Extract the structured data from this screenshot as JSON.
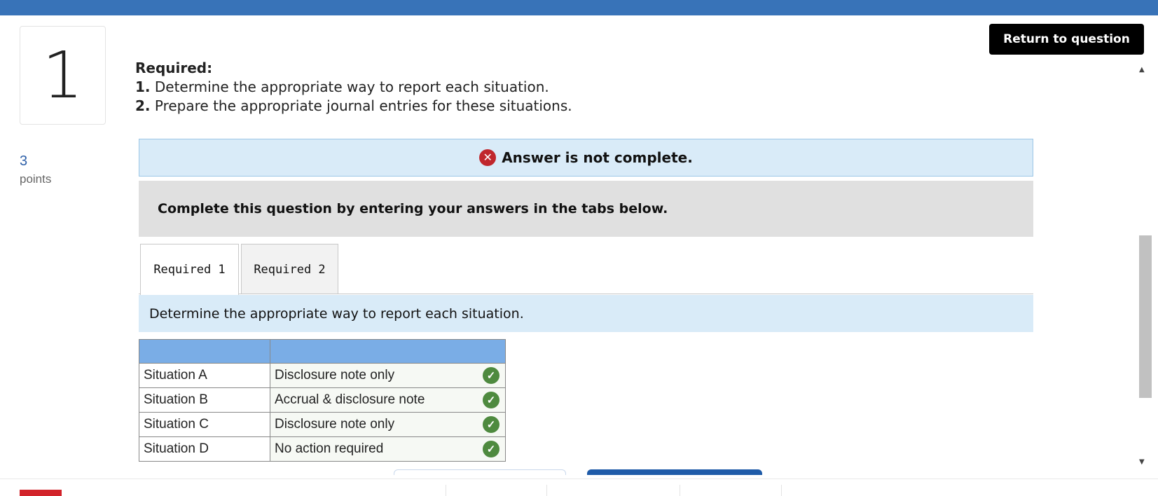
{
  "question": {
    "number": "1",
    "points_value": "3",
    "points_label": "points"
  },
  "header": {
    "return_label": "Return to question"
  },
  "required": {
    "title": "Required:",
    "items": [
      {
        "num": "1.",
        "text": "Determine the appropriate way to report each situation."
      },
      {
        "num": "2.",
        "text": "Prepare the appropriate journal entries for these situations."
      }
    ]
  },
  "alert": {
    "text": "Answer is not complete."
  },
  "instructions": {
    "text": "Complete this question by entering your answers in the tabs below."
  },
  "tabs": [
    {
      "label": "Required 1",
      "active": true
    },
    {
      "label": "Required 2",
      "active": false
    }
  ],
  "tab_description": "Determine the appropriate way to report each situation.",
  "table": {
    "headers": [
      "",
      ""
    ],
    "rows": [
      {
        "situation": "Situation A",
        "answer": "Disclosure note only"
      },
      {
        "situation": "Situation B",
        "answer": "Accrual & disclosure note"
      },
      {
        "situation": "Situation C",
        "answer": "Disclosure note only"
      },
      {
        "situation": "Situation D",
        "answer": "No action required"
      }
    ]
  },
  "colors": {
    "topbar": "#3873b8",
    "alert_bg": "#d9ebf8",
    "error_red": "#c0272d",
    "check_green": "#4e8a3f",
    "table_header": "#7aade6"
  }
}
